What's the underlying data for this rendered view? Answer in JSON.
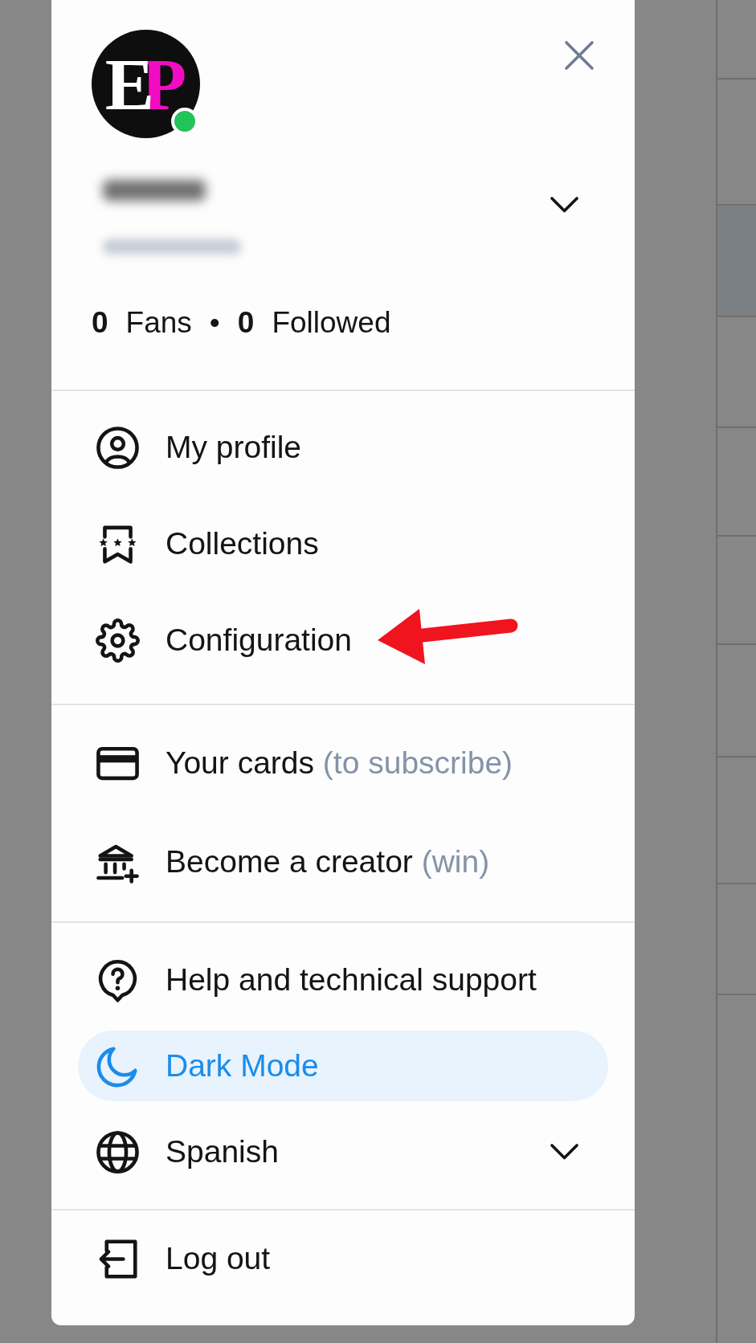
{
  "profile": {
    "avatar": {
      "letters": [
        {
          "text": "E",
          "color": "#ffffff"
        },
        {
          "text": "P",
          "color": "#f20cc4"
        }
      ],
      "online": true
    },
    "stats": [
      {
        "count": "0",
        "label": "Fans"
      },
      {
        "count": "0",
        "label": "Followed"
      }
    ],
    "stats_separator": "•"
  },
  "menu": {
    "sections": [
      {
        "items": [
          {
            "kind": "link",
            "label": "My profile",
            "selected": false,
            "pointed_at": false
          },
          {
            "kind": "link",
            "label": "Collections",
            "selected": false,
            "pointed_at": false
          },
          {
            "kind": "link",
            "label": "Configuration",
            "selected": false,
            "pointed_at": true
          }
        ]
      },
      {
        "items": [
          {
            "kind": "link",
            "label": "Your cards",
            "note": "(to subscribe)",
            "selected": false,
            "pointed_at": false
          },
          {
            "kind": "link",
            "label": "Become a creator",
            "note": "(win)",
            "selected": false,
            "pointed_at": false
          }
        ]
      },
      {
        "items": [
          {
            "kind": "link",
            "label": "Help and technical support",
            "selected": false,
            "pointed_at": false
          },
          {
            "kind": "link",
            "label": "Dark Mode",
            "selected": true,
            "pointed_at": false
          },
          {
            "kind": "dropdown",
            "label": "Spanish",
            "selected": false,
            "pointed_at": false
          }
        ]
      },
      {
        "items": [
          {
            "kind": "link",
            "label": "Log out",
            "selected": false,
            "pointed_at": false
          }
        ]
      }
    ]
  },
  "background_list": {
    "rows": [
      {
        "selected": false
      },
      {
        "selected": false
      },
      {
        "selected": true
      },
      {
        "selected": false
      },
      {
        "selected": false
      },
      {
        "selected": false
      },
      {
        "selected": false
      },
      {
        "selected": false
      },
      {
        "selected": false
      }
    ]
  }
}
